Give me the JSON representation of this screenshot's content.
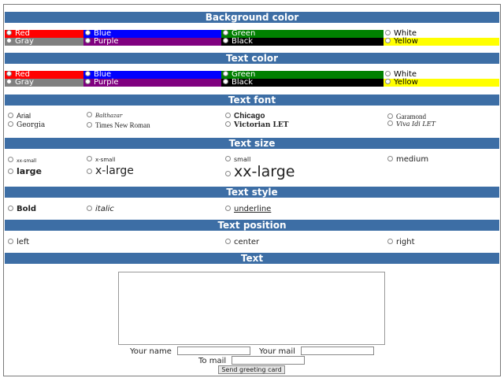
{
  "sections": {
    "background_color": "Background color",
    "text_color": "Text color",
    "text_font": "Text font",
    "text_size": "Text size",
    "text_style": "Text style",
    "text_position": "Text position",
    "text": "Text"
  },
  "colors": {
    "red": "Red",
    "blue": "Blue",
    "green": "Green",
    "white": "White",
    "gray": "Gray",
    "purple": "Purple",
    "black": "Black",
    "yellow": "Yellow"
  },
  "fonts": {
    "arial": "Arial",
    "balthazar": "Balthazar",
    "chicago": "Chicago",
    "garamond": "Garamond",
    "georgia": "Georgia",
    "times": "Times New Roman",
    "victorian": "Victorian LET",
    "vivaldi": "Viva Idi LET"
  },
  "sizes": {
    "xx_small": "xx-small",
    "x_small": "x-small",
    "small": "small",
    "medium": "medium",
    "large": "large",
    "x_large": "x-large",
    "xx_large": "xx-large"
  },
  "styles": {
    "bold": "Bold",
    "italic": "italic",
    "underline": "underline"
  },
  "positions": {
    "left": "left",
    "center": "center",
    "right": "right"
  },
  "form": {
    "your_name_label": "Your name",
    "your_mail_label": "Your mail",
    "to_mail_label": "To mail",
    "send_button": "Send greeting card"
  },
  "swatch_colors": {
    "red": "#ff0000",
    "blue": "#0000ff",
    "green": "#008000",
    "white": "#ffffff",
    "gray": "#808080",
    "purple": "#800080",
    "black": "#000000",
    "yellow": "#ffff00",
    "header": "#3d6ea5"
  }
}
